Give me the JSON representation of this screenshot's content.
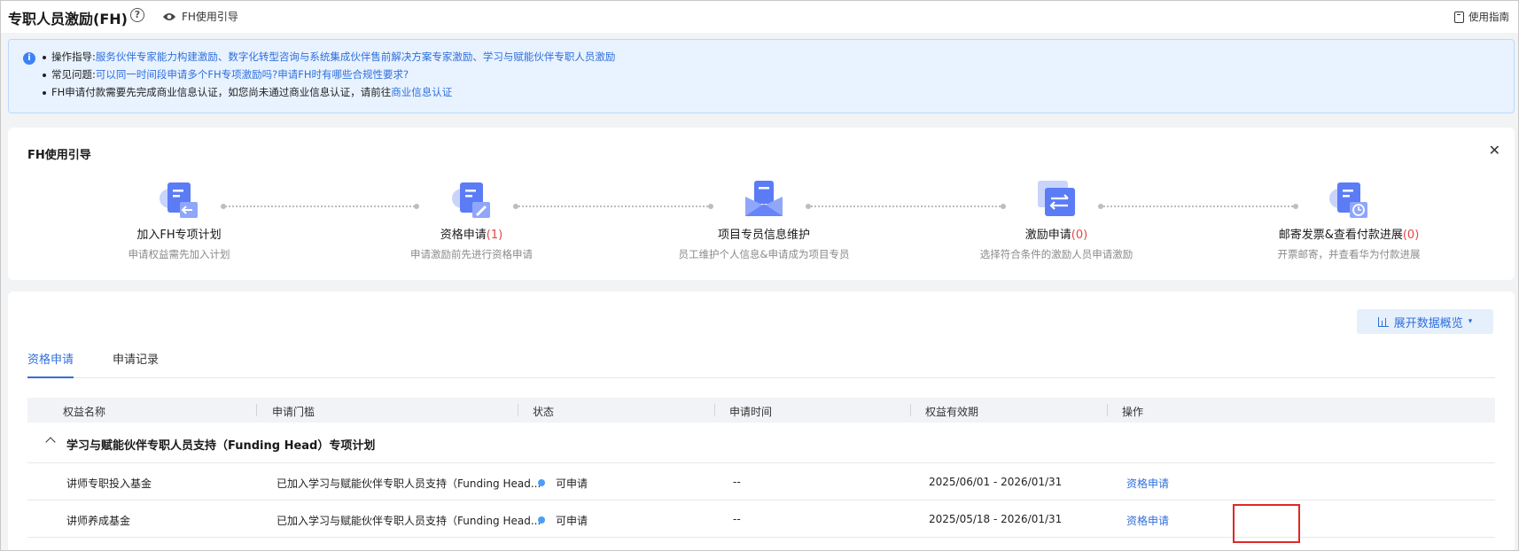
{
  "header": {
    "title": "专职人员激励(FH)",
    "guide_toggle": "FH使用引导",
    "manual": "使用指南"
  },
  "notice": {
    "line1_prefix": "操作指导:",
    "line1_link": "服务伙伴专家能力构建激励、数字化转型咨询与系统集成伙伴售前解决方案专家激励、学习与赋能伙伴专职人员激励",
    "line2_prefix": "常见问题:",
    "line2_link": "可以同一时间段申请多个FH专项激励吗?申请FH时有哪些合规性要求?",
    "line3_text": "FH申请付款需要先完成商业信息认证，如您尚未通过商业信息认证，请前往",
    "line3_link": "商业信息认证"
  },
  "guide": {
    "title": "FH使用引导",
    "steps": [
      {
        "label": "加入FH专项计划",
        "count": "",
        "sub": "申请权益需先加入计划"
      },
      {
        "label": "资格申请",
        "count": "(1)",
        "sub": "申请激励前先进行资格申请"
      },
      {
        "label": "项目专员信息维护",
        "count": "",
        "sub": "员工维护个人信息&申请成为项目专员"
      },
      {
        "label": "激励申请",
        "count": "(0)",
        "sub": "选择符合条件的激励人员申请激励"
      },
      {
        "label": "邮寄发票&查看付款进展",
        "count": "(0)",
        "sub": "开票邮寄，并查看华为付款进展"
      }
    ]
  },
  "main": {
    "overview_button": "展开数据概览",
    "tabs": [
      "资格申请",
      "申请记录"
    ],
    "columns": [
      "权益名称",
      "申请门槛",
      "状态",
      "申请时间",
      "权益有效期",
      "操作"
    ],
    "group_title": "学习与赋能伙伴专职人员支持（Funding Head）专项计划",
    "rows": [
      {
        "name": "讲师专职投入基金",
        "threshold": "已加入学习与赋能伙伴专职人员支持（Funding Head...",
        "status": "可申请",
        "time": "--",
        "validity": "2025/06/01 - 2026/01/31",
        "action": "资格申请"
      },
      {
        "name": "讲师养成基金",
        "threshold": "已加入学习与赋能伙伴专职人员支持（Funding Head...",
        "status": "可申请",
        "time": "--",
        "validity": "2025/05/18 - 2026/01/31",
        "action": "资格申请"
      }
    ]
  },
  "colors": {
    "accent": "#2f6fdc",
    "count_red": "#e54545",
    "status_dot": "#4a9ef5",
    "highlight": "#e02828"
  }
}
